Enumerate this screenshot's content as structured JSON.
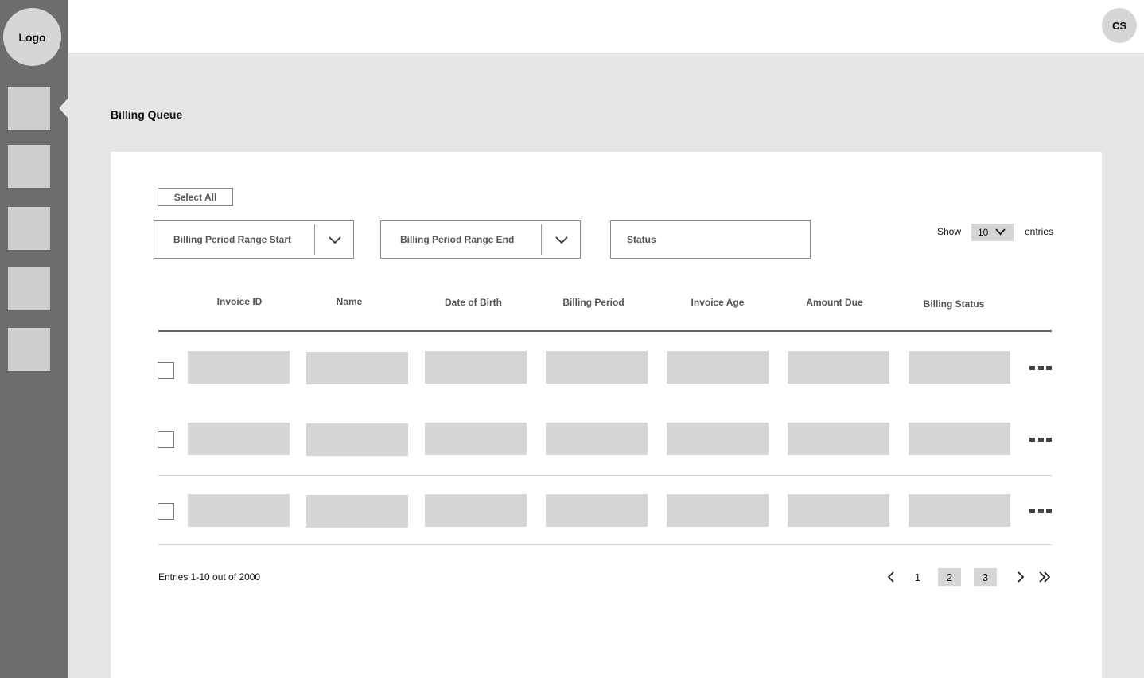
{
  "sidebar": {
    "logo_label": "Logo",
    "nav_items": [
      {
        "icon": "placeholder-block"
      },
      {
        "icon": "placeholder-block"
      },
      {
        "icon": "placeholder-block"
      },
      {
        "icon": "placeholder-block"
      },
      {
        "icon": "placeholder-block"
      }
    ]
  },
  "header": {
    "avatar_initials": "CS"
  },
  "page": {
    "title": "Billing Queue"
  },
  "filters": {
    "select_all_label": "Select All",
    "range_start_label": "Billing Period Range Start",
    "range_end_label": "Billing Period Range End",
    "status_placeholder": "Status",
    "show_label": "Show",
    "entries_value": "10",
    "entries_label": "entries"
  },
  "table": {
    "columns": [
      "Invoice ID",
      "Name",
      "Date of Birth",
      "Billing Period",
      "Invoice Age",
      "Amount Due",
      "Billing Status"
    ],
    "row_count": 3
  },
  "footer": {
    "entries_text": "Entries 1-10 out of 2000",
    "pages": [
      "1",
      "2",
      "3"
    ]
  },
  "colors": {
    "sidebar_bg": "#6d6d6d",
    "page_bg": "#e6e6e6",
    "placeholder_fill": "#d6d6d6"
  }
}
